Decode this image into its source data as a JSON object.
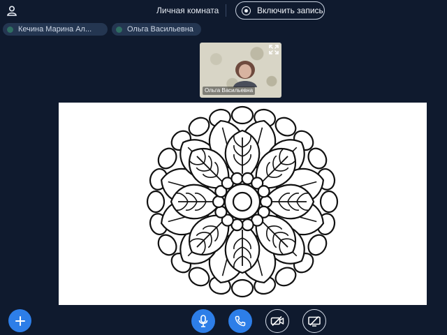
{
  "header": {
    "user_icon": "user-icon",
    "room_title": "Личная комната",
    "record_label": "Включить запись",
    "record_icon": "record-icon"
  },
  "participants": [
    {
      "name": "Кечина Марина Ал...",
      "status_color": "#2f6e62"
    },
    {
      "name": "Ольга Васильевна",
      "status_color": "#2f6e62"
    }
  ],
  "video_tile": {
    "name": "Ольга Васильевна",
    "expand_icon": "expand-icon"
  },
  "screen_share": {
    "content": "mandala-coloring-page"
  },
  "controls": {
    "add_icon": "plus-icon",
    "microphone_icon": "microphone-icon",
    "phone_icon": "phone-icon",
    "camera_off_icon": "camera-off-icon",
    "screen_share_off_icon": "screen-share-off-icon"
  },
  "colors": {
    "background": "#0f1a2e",
    "accent": "#2d7ee8",
    "chip_bg": "#243651",
    "status_dot": "#2f6e62"
  }
}
